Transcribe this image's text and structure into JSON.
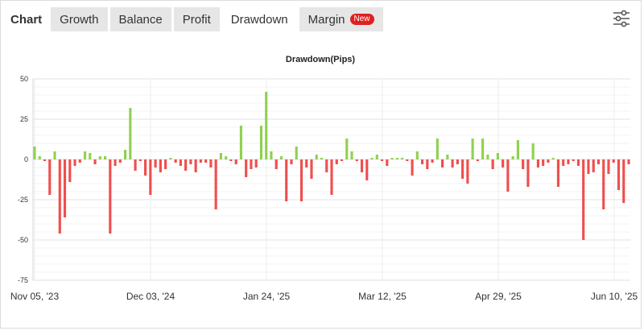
{
  "tabs": [
    {
      "label": "Chart",
      "active": false
    },
    {
      "label": "Growth",
      "active": false
    },
    {
      "label": "Balance",
      "active": false
    },
    {
      "label": "Profit",
      "active": false
    },
    {
      "label": "Drawdown",
      "active": true
    },
    {
      "label": "Margin",
      "active": false,
      "badge": "New"
    }
  ],
  "settings_icon": "sliders-icon",
  "colors": {
    "positive": "#8fd14f",
    "negative": "#f04e4e",
    "grid": "#e6e6e6"
  },
  "chart_data": {
    "type": "bar",
    "title": "Drawdown(Pips)",
    "xlabel": "",
    "ylabel": "",
    "ylim": [
      -75,
      50
    ],
    "yticks": [
      50,
      25,
      0,
      -25,
      -50,
      -75
    ],
    "x_tick_labels": [
      "Nov 05, '23",
      "Dec 03, '24",
      "Jan 24, '25",
      "Mar 12, '25",
      "Apr 29, '25",
      "Jun 10, '25"
    ],
    "grid": true,
    "legend": "none",
    "values": [
      8,
      2,
      -1,
      -22,
      5,
      -46,
      -36,
      -14,
      -4,
      -2,
      5,
      4,
      -3,
      2,
      2,
      -46,
      -4,
      -2,
      6,
      32,
      -7,
      -1,
      -10,
      -22,
      -5,
      -8,
      -6,
      1,
      -2,
      -4,
      -7,
      -3,
      -8,
      -2,
      -2,
      -5,
      -31,
      4,
      2,
      -1,
      -3,
      21,
      -11,
      -6,
      -5,
      21,
      42,
      5,
      -6,
      2,
      -26,
      -3,
      8,
      -26,
      -5,
      -12,
      3,
      1,
      -8,
      -22,
      -3,
      -1,
      13,
      5,
      -1,
      -8,
      -13,
      1,
      3,
      -1,
      -4,
      1,
      1,
      1,
      -1,
      -10,
      5,
      -3,
      -6,
      -2,
      13,
      -5,
      3,
      -5,
      -3,
      -12,
      -15,
      13,
      -1,
      13,
      3,
      -6,
      4,
      -5,
      -20,
      2,
      12,
      -6,
      -17,
      10,
      -5,
      -4,
      -2,
      1,
      -17,
      -4,
      -3,
      -1,
      -4,
      -50,
      -9,
      -8,
      -3,
      -31,
      -9,
      -2,
      -19,
      -27,
      -3
    ]
  }
}
